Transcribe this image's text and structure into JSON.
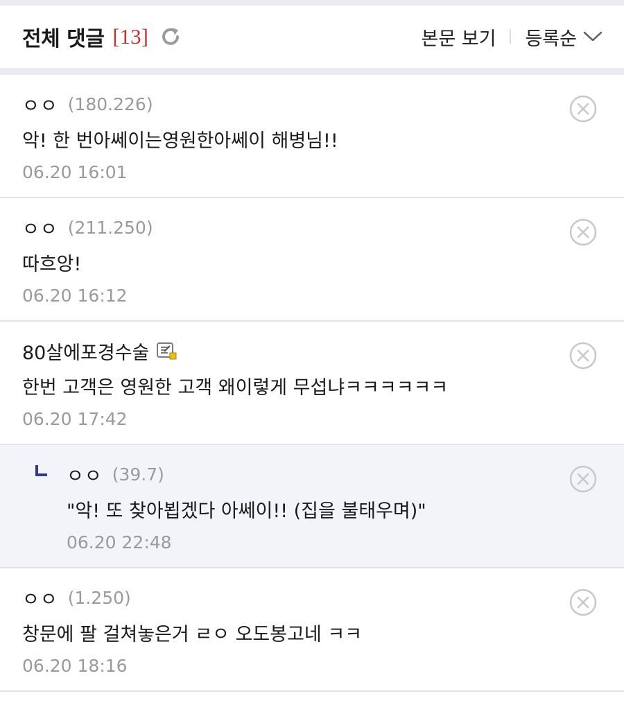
{
  "header": {
    "title": "전체 댓글",
    "count": "[13]",
    "view_body_label": "본문 보기",
    "sort_label": "등록순"
  },
  "comments": [
    {
      "nick": "ㅇㅇ",
      "ip": "(180.226)",
      "text": "악! 한 번아쎄이는영원한아쎄이 해병님!!",
      "date": "06.20 16:01",
      "reply": false,
      "member": false
    },
    {
      "nick": "ㅇㅇ",
      "ip": "(211.250)",
      "text": "따흐앙!",
      "date": "06.20 16:12",
      "reply": false,
      "member": false
    },
    {
      "nick": "80살에포경수술",
      "ip": "",
      "text": "한번 고객은 영원한 고객 왜이렇게 무섭냐ㅋㅋㅋㅋㅋㅋ",
      "date": "06.20 17:42",
      "reply": false,
      "member": true
    },
    {
      "nick": "ㅇㅇ",
      "ip": "(39.7)",
      "text": "\"악! 또 찾아뵙겠다 아쎄이!! (집을 불태우며)\"",
      "date": "06.20 22:48",
      "reply": true,
      "member": false
    },
    {
      "nick": "ㅇㅇ",
      "ip": "(1.250)",
      "text": "창문에 팔 걸쳐놓은거 ㄹㅇ 오도봉고네 ㅋㅋ",
      "date": "06.20 18:16",
      "reply": false,
      "member": false
    }
  ],
  "colors": {
    "accent_count": "#c33434",
    "reply_background": "#f3f4fa",
    "reply_arrow": "#2f3a8f",
    "meta_gray": "#9a9a9a"
  },
  "icons": {
    "refresh": "refresh-icon",
    "sort": "chevron-down-icon",
    "delete": "delete-icon",
    "reply": "reply-arrow-icon",
    "member": "fixed-member-icon"
  }
}
